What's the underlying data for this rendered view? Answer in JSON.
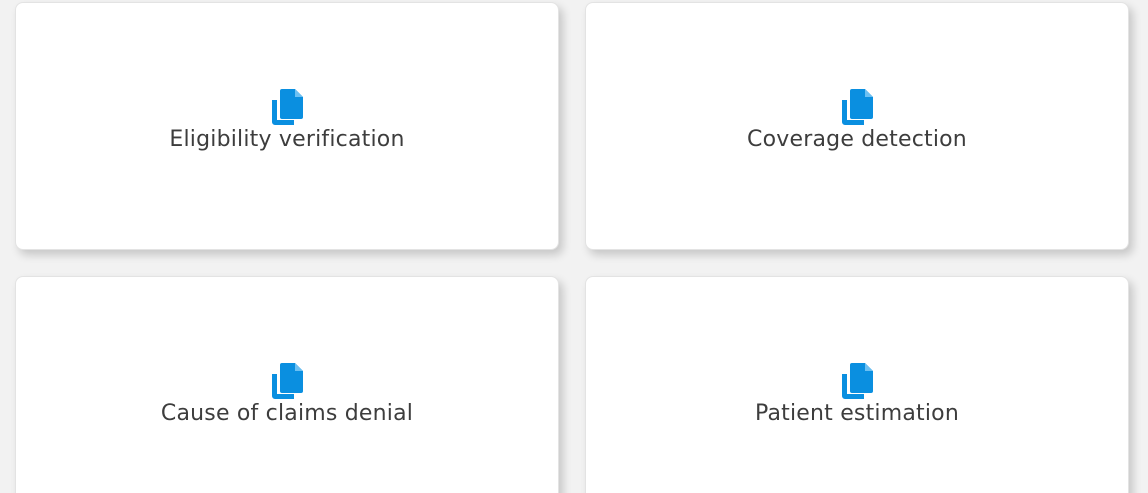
{
  "colors": {
    "accent": "#0a8fe0",
    "card_background": "#ffffff",
    "page_background": "#f2f2f2",
    "label_text": "#3d3d3d"
  },
  "cards": [
    {
      "label": "Eligibility verification",
      "icon": "copy-documents-icon"
    },
    {
      "label": "Coverage detection",
      "icon": "copy-documents-icon"
    },
    {
      "label": "Cause of claims denial",
      "icon": "copy-documents-icon"
    },
    {
      "label": "Patient estimation",
      "icon": "copy-documents-icon"
    }
  ]
}
